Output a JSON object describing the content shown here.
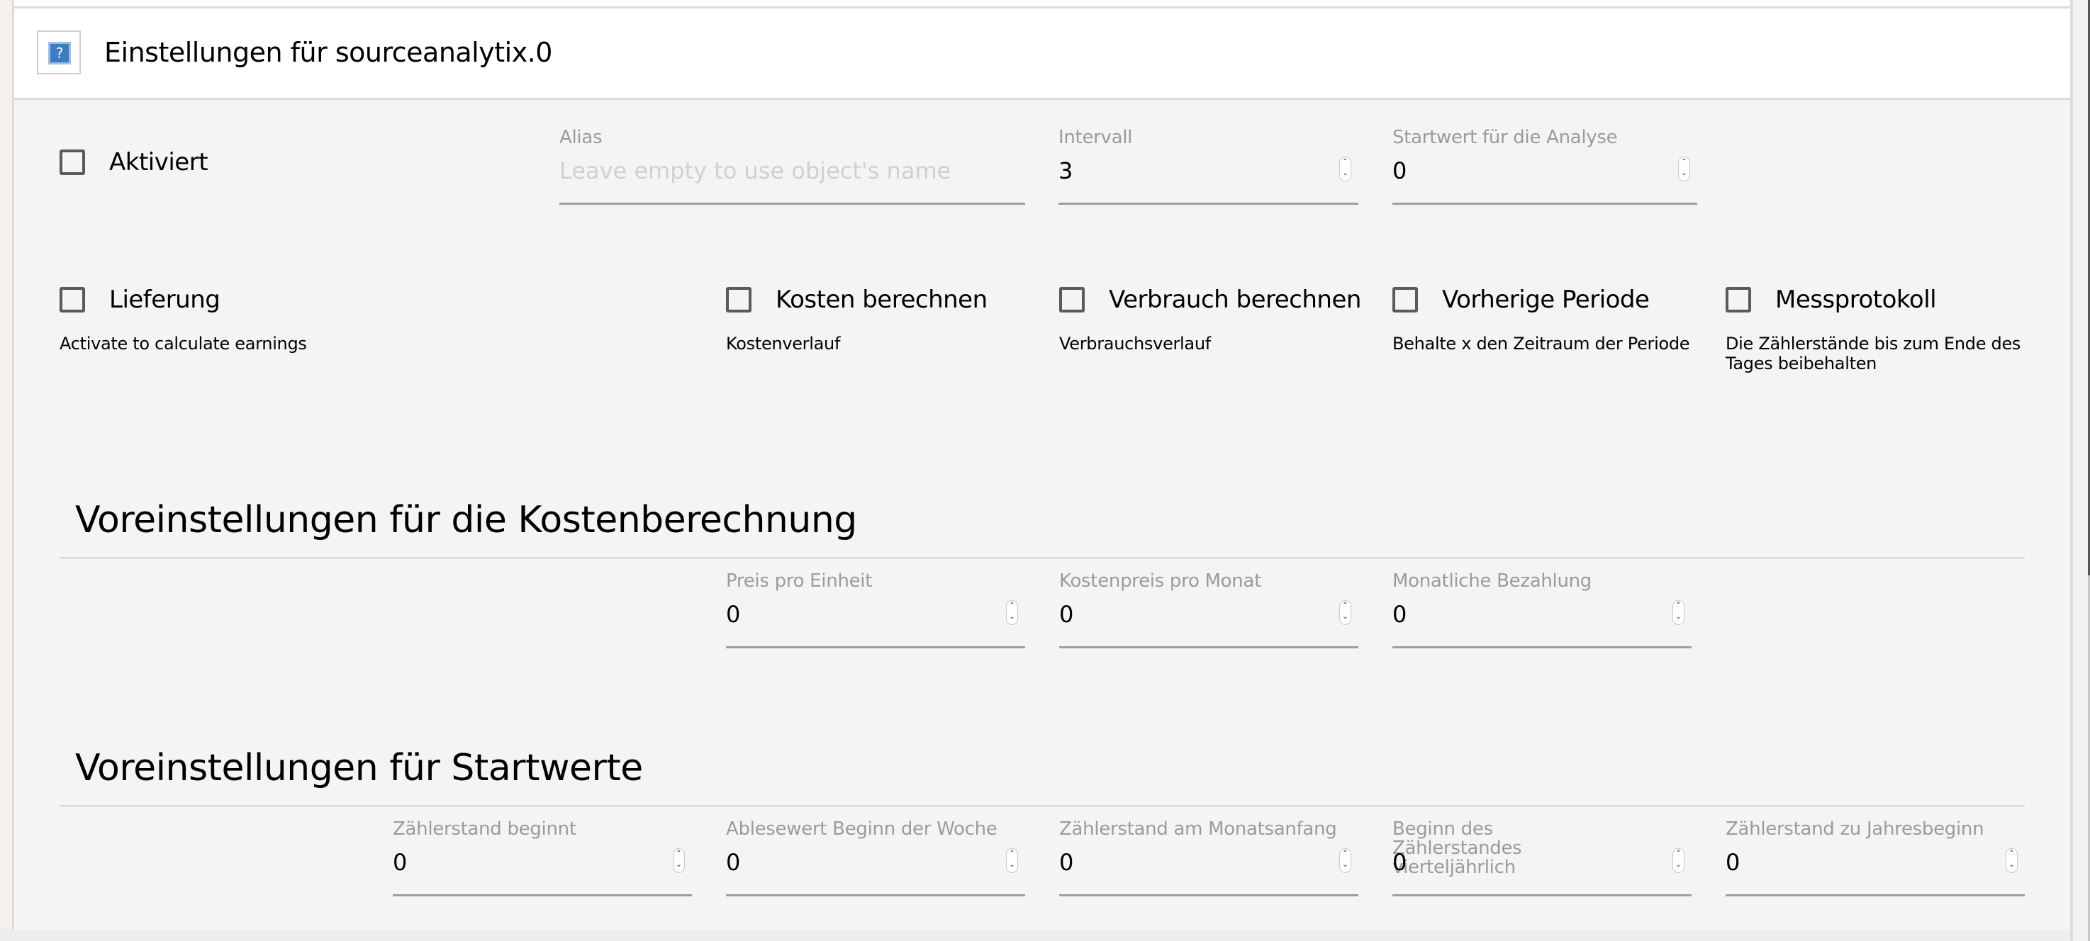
{
  "header": {
    "icon": "help-question-icon",
    "title": "Einstellungen für sourceanalytix.0"
  },
  "general": {
    "activated": {
      "label": "Aktiviert",
      "checked": false
    },
    "alias": {
      "label": "Alias",
      "value": "",
      "placeholder": "Leave empty to use object's name"
    },
    "interval": {
      "label": "Intervall",
      "value": "3"
    },
    "start_value": {
      "label": "Startwert für die Analyse",
      "value": "0"
    }
  },
  "options": [
    {
      "label": "Lieferung",
      "description": "Activate to calculate earnings",
      "checked": false
    },
    {
      "label": "Kosten berechnen",
      "description": "Kostenverlauf",
      "checked": false
    },
    {
      "label": "Verbrauch berechnen",
      "description": "Verbrauchsverlauf",
      "checked": false
    },
    {
      "label": "Vorherige Periode",
      "description": "Behalte x den Zeitraum der Periode",
      "checked": false
    },
    {
      "label": "Messprotokoll",
      "description": "Die Zählerstände bis zum Ende des Tages beibehalten",
      "checked": false
    }
  ],
  "cost_section": {
    "heading": "Voreinstellungen für die Kostenberechnung",
    "fields": [
      {
        "label": "Preis pro Einheit",
        "value": "0"
      },
      {
        "label": "Kostenpreis pro Monat",
        "value": "0"
      },
      {
        "label": "Monatliche Bezahlung",
        "value": "0"
      }
    ]
  },
  "start_section": {
    "heading": "Voreinstellungen für Startwerte",
    "fields": [
      {
        "label": "Zählerstand beginnt",
        "value": "0"
      },
      {
        "label": "Ablesewert Beginn der Woche",
        "value": "0"
      },
      {
        "label": "Zählerstand am Monatsanfang",
        "value": "0"
      },
      {
        "label": "Beginn des Zählerstandes vierteljährlich",
        "value": "0"
      },
      {
        "label": "Zählerstand zu Jahresbeginn",
        "value": "0"
      }
    ]
  },
  "colors": {
    "icon_blue": "#3b7dc0",
    "label_gray": "#9b9b9b",
    "underline_gray": "#9e9e9e",
    "panel_bg": "#f4f4f4"
  }
}
